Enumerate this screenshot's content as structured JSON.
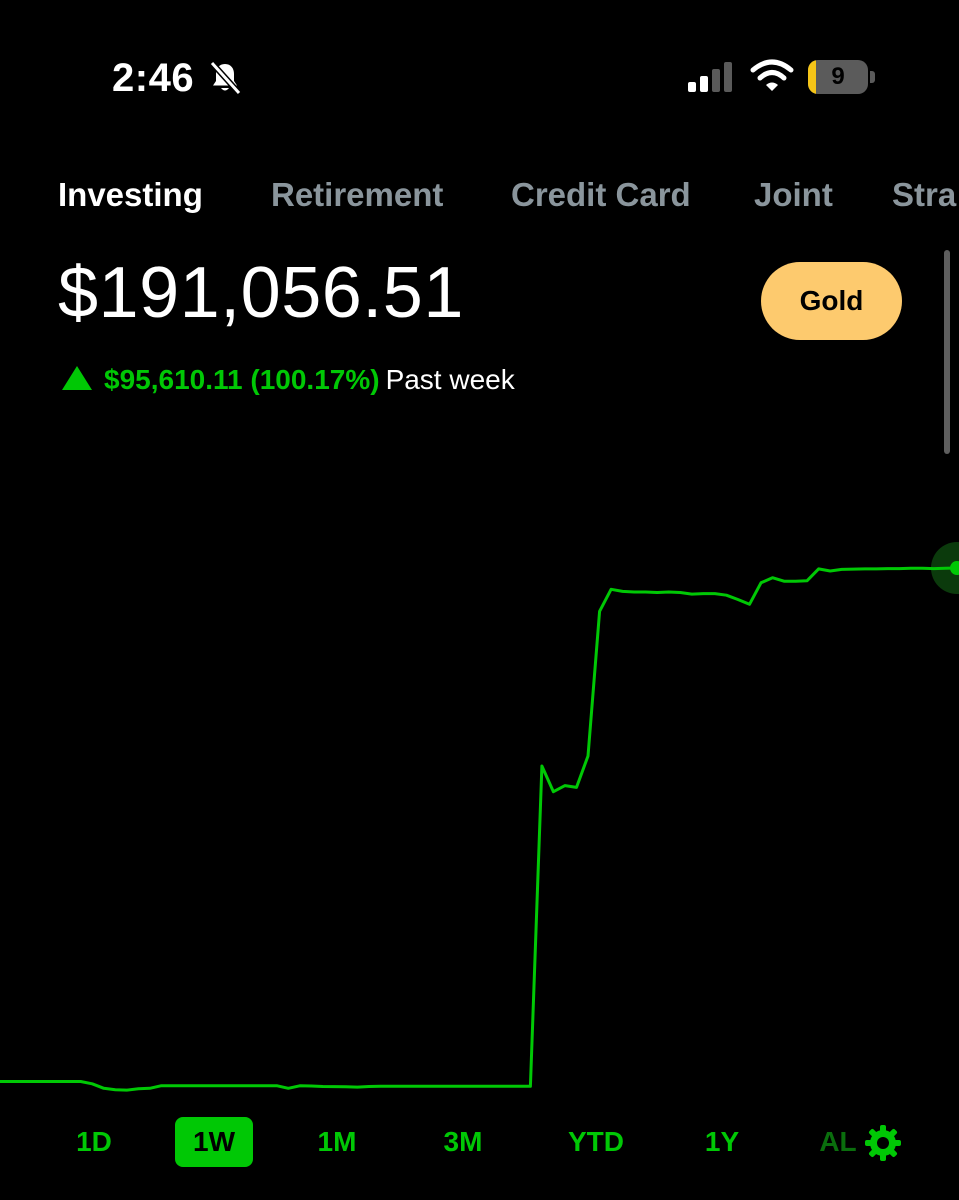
{
  "status_bar": {
    "time": "2:46",
    "battery": "9",
    "icons": [
      "bell-slash-icon",
      "signal-icon",
      "wifi-icon",
      "battery-icon"
    ]
  },
  "tabs": [
    {
      "label": "Investing",
      "active": true
    },
    {
      "label": "Retirement",
      "active": false
    },
    {
      "label": "Credit Card",
      "active": false
    },
    {
      "label": "Joint",
      "active": false
    },
    {
      "label": "Stra",
      "active": false
    }
  ],
  "portfolio": {
    "balance": "$191,056.51",
    "change": "$95,610.11 (100.17%)",
    "period": "Past week",
    "gold_label": "Gold"
  },
  "colors": {
    "accent_green": "#00c805",
    "gold": "#fdca6e",
    "inactive_tab": "#8a959c"
  },
  "time_ranges": [
    {
      "label": "1D",
      "active": false
    },
    {
      "label": "1W",
      "active": true
    },
    {
      "label": "1M",
      "active": false
    },
    {
      "label": "3M",
      "active": false
    },
    {
      "label": "YTD",
      "active": false
    },
    {
      "label": "1Y",
      "active": false
    },
    {
      "label": "AL",
      "active": false
    }
  ],
  "chart_data": {
    "type": "line",
    "title": "",
    "xlabel": "",
    "ylabel": "",
    "grid": false,
    "series": [
      {
        "values": [
          95446.4,
          95446.4,
          95446.4,
          95446.4,
          95446.4,
          95446.4,
          95446.4,
          95446.4,
          95022.0,
          94180.0,
          93920.0,
          93850.0,
          94080.0,
          94180.0,
          94660.0,
          94660.0,
          94660.0,
          94660.0,
          94660.0,
          94660.0,
          94660.0,
          94660.0,
          94660.0,
          94660.0,
          94660.0,
          94180.0,
          94640.0,
          94600.0,
          94520.0,
          94500.0,
          94480.0,
          94400.0,
          94520.0,
          94560.0,
          94560.0,
          94560.0,
          94560.0,
          94560.0,
          94560.0,
          94560.0,
          94560.0,
          94560.0,
          94560.0,
          94560.0,
          94560.0,
          94560.0,
          94560.0,
          154200.0,
          149400.0,
          150550.0,
          150200.0,
          156060.0,
          183000.0,
          187100.0,
          186700.0,
          186600.0,
          186600.0,
          186500.0,
          186600.0,
          186500.0,
          186200.0,
          186300.0,
          186300.0,
          186000.0,
          185200.0,
          184300.0,
          188300.0,
          189250.0,
          188600.0,
          188600.0,
          188700.0,
          190900.0,
          190500.0,
          190800.0,
          190850.0,
          190900.0,
          190900.0,
          190950.0,
          190950.0,
          191000.0,
          191000.0,
          190950.0,
          191000.0,
          191056.51
        ]
      }
    ],
    "ylim": [
      92000,
      200000
    ]
  }
}
